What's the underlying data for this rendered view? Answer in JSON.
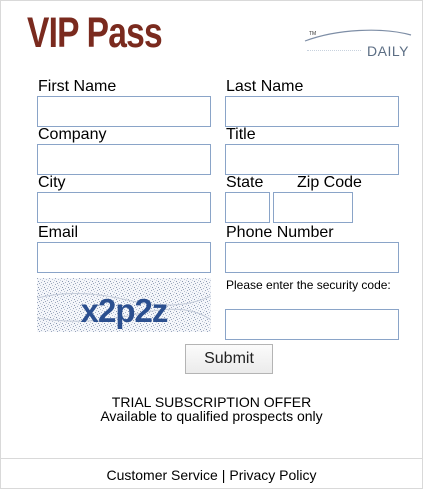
{
  "header": {
    "title": "VIP Pass",
    "logo_tm": "TM",
    "logo_word": "DAILY"
  },
  "form": {
    "first_name_label": "First Name",
    "last_name_label": "Last Name",
    "company_label": "Company",
    "title_label": "Title",
    "city_label": "City",
    "state_label": "State",
    "zip_label": "Zip Code",
    "email_label": "Email",
    "phone_label": "Phone Number",
    "first_name_value": "",
    "last_name_value": "",
    "company_value": "",
    "title_value": "",
    "city_value": "",
    "state_value": "",
    "zip_value": "",
    "email_value": "",
    "phone_value": "",
    "captcha_value": ""
  },
  "captcha": {
    "text": "x2p2z",
    "hint": "Please enter the security code:"
  },
  "submit_label": "Submit",
  "offer": {
    "line1": "TRIAL SUBSCRIPTION OFFER",
    "line2": "Available to qualified prospects only"
  },
  "footer": {
    "customer_service": "Customer Service",
    "separator": "|",
    "privacy_policy": "Privacy Policy"
  },
  "colors": {
    "title": "#7a2a1e",
    "input_border": "#8aa4c8",
    "captcha_text": "#2b4f8f",
    "logo_text": "#5c6e84"
  }
}
